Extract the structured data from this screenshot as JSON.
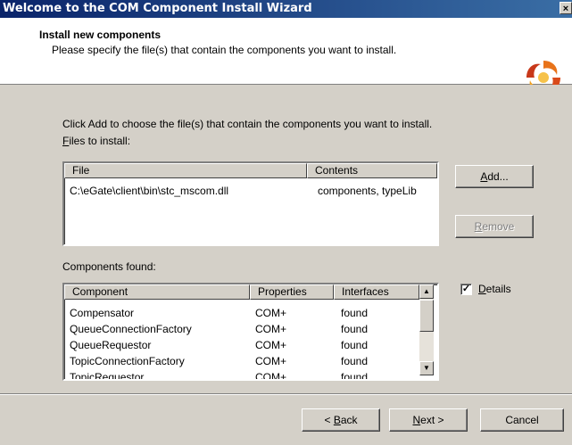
{
  "window": {
    "title": "Welcome to the COM Component Install Wizard",
    "close_glyph": "×"
  },
  "header": {
    "title": "Install new components",
    "subtitle": "Please specify the file(s) that contain the components you want to install."
  },
  "instruction": "Click Add to choose the file(s) that contain the components you want to install.",
  "files": {
    "label_accel": "F",
    "label_rest": "iles to install:",
    "columns": [
      "File",
      "Contents"
    ],
    "rows": [
      {
        "file": "C:\\eGate\\client\\bin\\stc_mscom.dll",
        "contents": "components, typeLib"
      }
    ]
  },
  "buttons": {
    "add_accel": "A",
    "add_rest": "dd...",
    "remove_accel": "R",
    "remove_rest": "emove",
    "back_prefix": "< ",
    "back_accel": "B",
    "back_rest": "ack",
    "next_accel": "N",
    "next_rest": "ext >",
    "cancel": "Cancel"
  },
  "components": {
    "label": "Components found:",
    "columns": [
      "Component",
      "Properties",
      "Interfaces"
    ],
    "rows": [
      {
        "component": "Compensator",
        "properties": "COM+",
        "interfaces": "found"
      },
      {
        "component": "QueueConnectionFactory",
        "properties": "COM+",
        "interfaces": "found"
      },
      {
        "component": "QueueRequestor",
        "properties": "COM+",
        "interfaces": "found"
      },
      {
        "component": "TopicConnectionFactory",
        "properties": "COM+",
        "interfaces": "found"
      },
      {
        "component": "TopicRequestor",
        "properties": "COM+",
        "interfaces": "found"
      }
    ]
  },
  "details": {
    "checked": true,
    "check_glyph": "✓",
    "label_accel": "D",
    "label_rest": "etails"
  },
  "scroll": {
    "up_glyph": "▲",
    "down_glyph": "▼"
  }
}
